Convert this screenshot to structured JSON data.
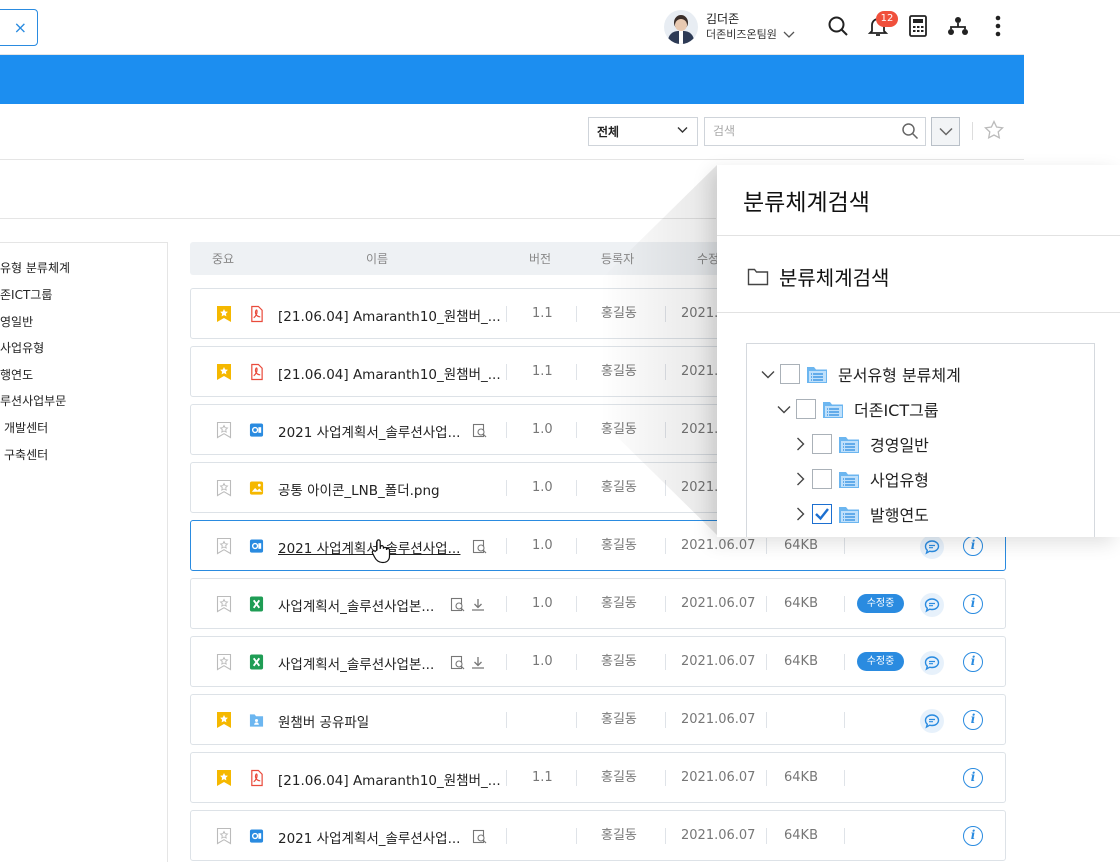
{
  "header": {
    "close_glyph": "×",
    "user_name": "김더존",
    "user_team": "더존비즈온팀원",
    "notification_count": "12",
    "icons": [
      "search-icon",
      "bell-icon",
      "calculator-icon",
      "org-chart-icon",
      "more-icon"
    ]
  },
  "colors": {
    "accent": "#1c8ef0",
    "link": "#2a8be0",
    "star": "#f5b800",
    "pdf": "#e94b3c",
    "doc": "#2a8be0",
    "xls": "#1f9d55"
  },
  "search": {
    "scope_value": "전체",
    "placeholder": "검색"
  },
  "left_tree": {
    "items": [
      "유형 분류체계",
      "존ICT그룹",
      "영일반",
      "사업유형",
      "행연도",
      "루션사업부문",
      "개발센터",
      "구축센터"
    ]
  },
  "table": {
    "headers": {
      "important": "중요",
      "name": "이름",
      "version": "버전",
      "registrant": "등록자",
      "modified": "수정"
    },
    "rows": [
      {
        "starred": true,
        "type": "pdf",
        "name": "[21.06.04] Amaranth10_원챔버_...",
        "version": "1.1",
        "registrant": "홍길동",
        "date": "2021.0",
        "size": "",
        "status": "",
        "comment": false,
        "info": false,
        "preview": false,
        "download": false
      },
      {
        "starred": true,
        "type": "pdf",
        "name": "[21.06.04] Amaranth10_원챔버_...",
        "version": "1.1",
        "registrant": "홍길동",
        "date": "2021.0",
        "size": "",
        "status": "",
        "comment": false,
        "info": false,
        "preview": false,
        "download": false
      },
      {
        "starred": false,
        "type": "doc",
        "name": "2021 사업계획서_솔루션사업...",
        "version": "1.0",
        "registrant": "홍길동",
        "date": "2021.0",
        "size": "",
        "status": "",
        "comment": false,
        "info": false,
        "preview": true,
        "download": false
      },
      {
        "starred": false,
        "type": "img",
        "name": "공통 아이콘_LNB_폴더.png",
        "version": "1.0",
        "registrant": "홍길동",
        "date": "2021.0",
        "size": "",
        "status": "",
        "comment": false,
        "info": false,
        "preview": false,
        "download": false
      },
      {
        "starred": false,
        "type": "doc",
        "name": "2021 사업계획서_솔루션사업...",
        "version": "1.0",
        "registrant": "홍길동",
        "date": "2021.06.07",
        "size": "64KB",
        "status": "",
        "comment": true,
        "info": true,
        "preview": true,
        "download": false,
        "selected": true
      },
      {
        "starred": false,
        "type": "xls",
        "name": "사업계획서_솔루션사업본...",
        "version": "1.0",
        "registrant": "홍길동",
        "date": "2021.06.07",
        "size": "64KB",
        "status": "수정중",
        "comment": true,
        "info": true,
        "preview": true,
        "download": true
      },
      {
        "starred": false,
        "type": "xls",
        "name": "사업계획서_솔루션사업본...",
        "version": "1.0",
        "registrant": "홍길동",
        "date": "2021.06.07",
        "size": "64KB",
        "status": "수정중",
        "comment": true,
        "info": true,
        "preview": true,
        "download": true
      },
      {
        "starred": true,
        "type": "folder",
        "name": "원챔버 공유파일",
        "version": "",
        "registrant": "홍길동",
        "date": "2021.06.07",
        "size": "",
        "status": "",
        "comment": true,
        "info": true,
        "preview": false,
        "download": false
      },
      {
        "starred": true,
        "type": "pdf",
        "name": "[21.06.04] Amaranth10_원챔버_...",
        "version": "1.1",
        "registrant": "홍길동",
        "date": "2021.06.07",
        "size": "64KB",
        "status": "",
        "comment": false,
        "info": true,
        "preview": false,
        "download": false
      },
      {
        "starred": false,
        "type": "doc",
        "name": "2021 사업계획서_솔루션사업...",
        "version": "",
        "registrant": "홍길동",
        "date": "2021.06.07",
        "size": "64KB",
        "status": "",
        "comment": false,
        "info": true,
        "preview": true,
        "download": false
      }
    ]
  },
  "popup": {
    "title": "분류체계검색",
    "subtitle": "분류체계검색",
    "tree": [
      {
        "label": "문서유형 분류체계",
        "depth": 0,
        "expanded": true,
        "checked": false
      },
      {
        "label": "더존ICT그룹",
        "depth": 1,
        "expanded": true,
        "checked": false
      },
      {
        "label": "경영일반",
        "depth": 2,
        "expanded": false,
        "checked": false
      },
      {
        "label": "사업유형",
        "depth": 2,
        "expanded": false,
        "checked": false
      },
      {
        "label": "발행연도",
        "depth": 2,
        "expanded": false,
        "checked": true
      }
    ]
  }
}
